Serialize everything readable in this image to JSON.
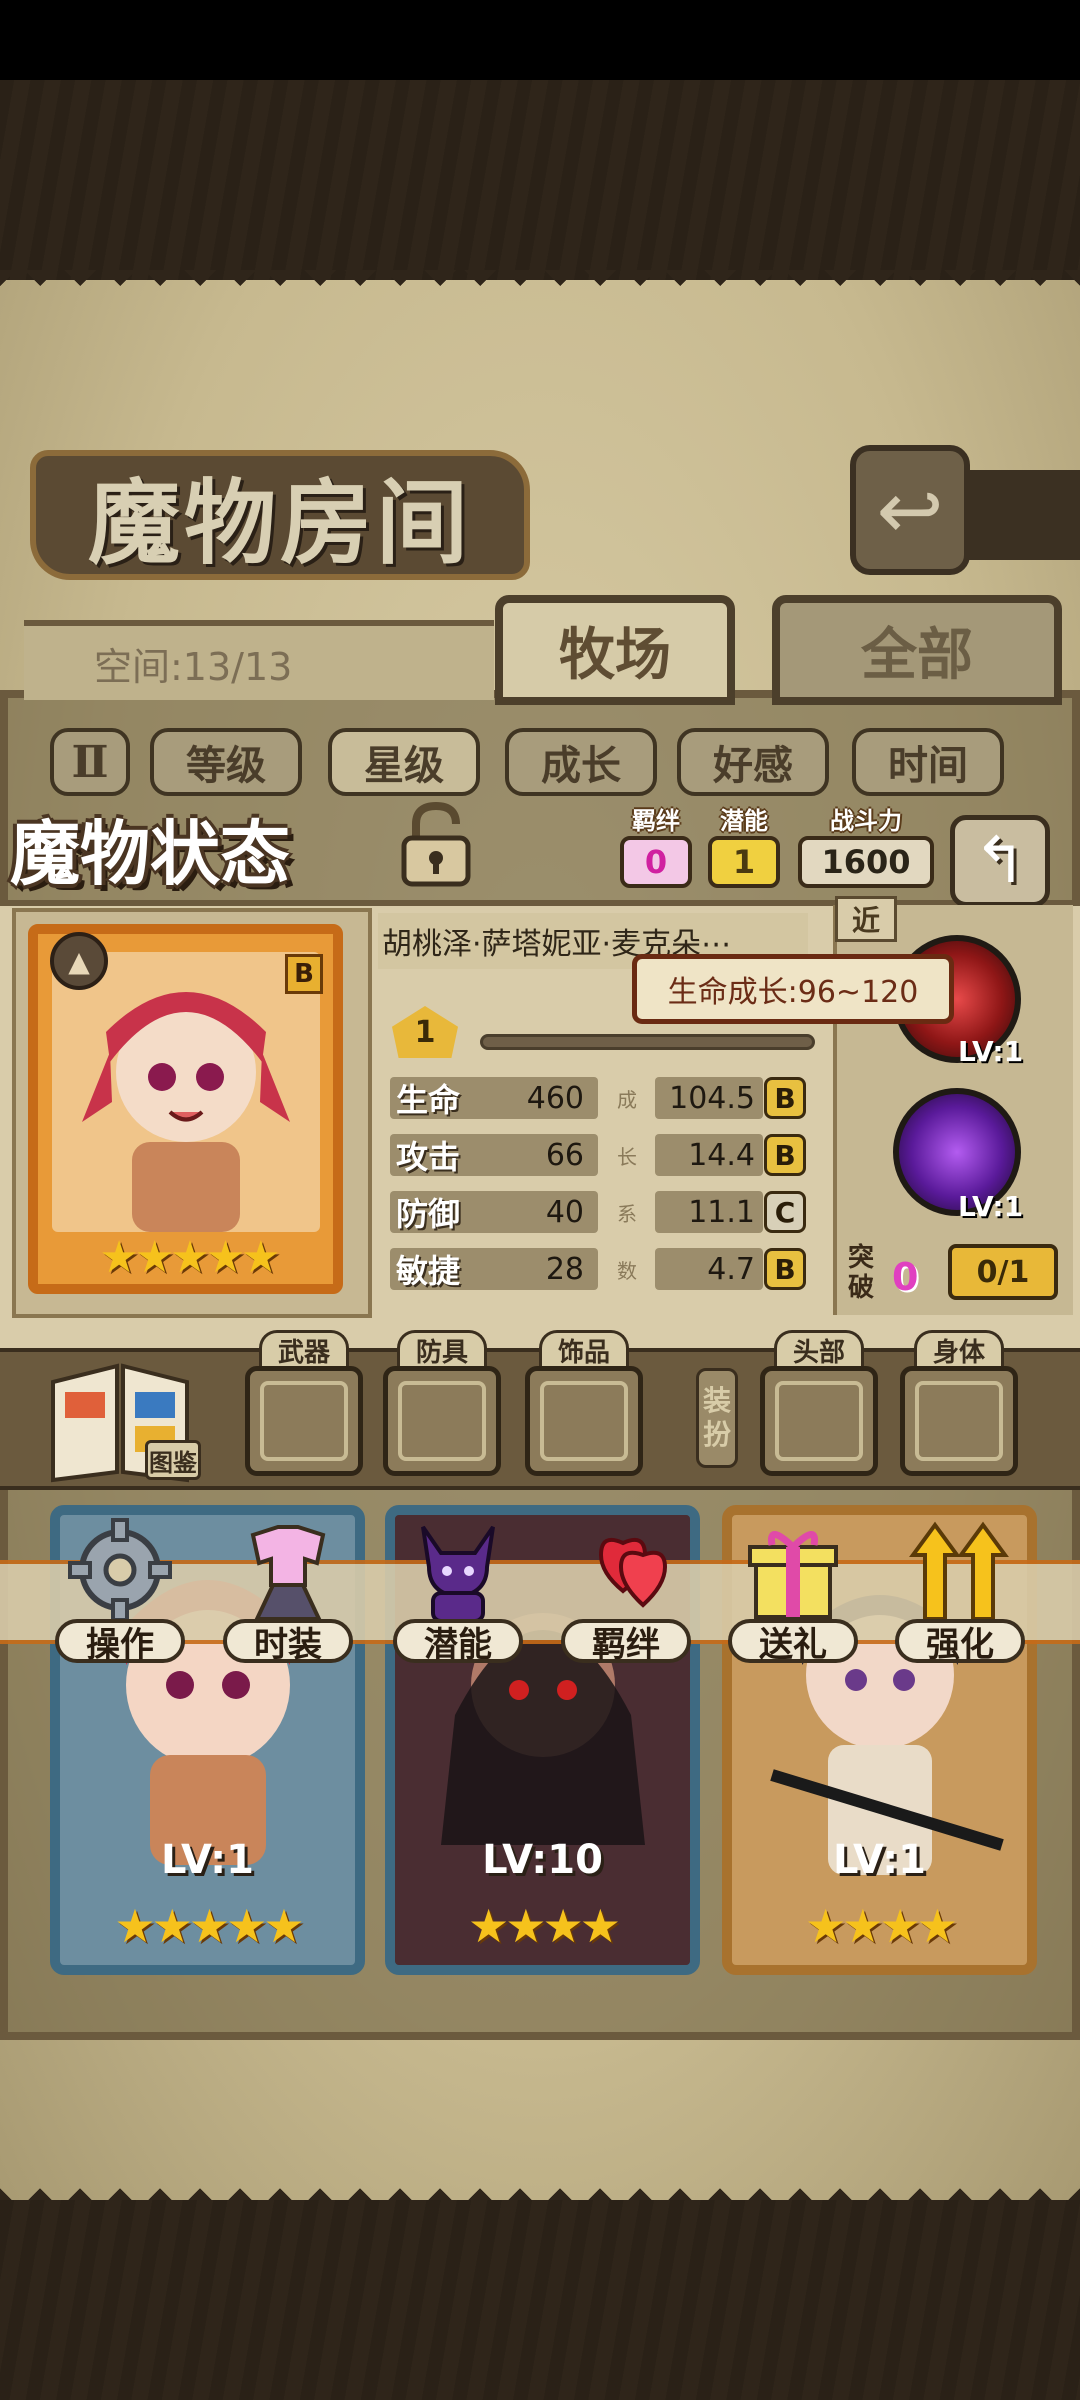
{
  "header": {
    "title": "魔物房间"
  },
  "storage": {
    "space_text": "空间:13/13"
  },
  "tabs": [
    {
      "label": "牧场"
    },
    {
      "label": "全部"
    }
  ],
  "sort": {
    "toggle_icon": "Ⅱ",
    "options": [
      "等级",
      "星级",
      "成长",
      "好感",
      "时间"
    ],
    "selected": "星级"
  },
  "status": {
    "title": "魔物状态",
    "bond": {
      "label": "羁绊",
      "value": "0"
    },
    "potential": {
      "label": "潜能",
      "value": "1"
    },
    "power": {
      "label": "战斗力",
      "value": "1600"
    },
    "monster_name": "胡桃泽·萨塔妮亚·麦克朵⋯",
    "rank": "B",
    "level_badge": "1",
    "tooltip": "生命成长:96~120",
    "stats": [
      {
        "name": "生命",
        "value": "460",
        "coef_char": "成",
        "coef": "104.5",
        "grade": "B"
      },
      {
        "name": "攻击",
        "value": "66",
        "coef_char": "长",
        "coef": "14.4",
        "grade": "B"
      },
      {
        "name": "防御",
        "value": "40",
        "coef_char": "系",
        "coef": "11.1",
        "grade": "C"
      },
      {
        "name": "敏捷",
        "value": "28",
        "coef_char": "数",
        "coef": "4.7",
        "grade": "B"
      }
    ],
    "stars": "★★★★★",
    "range": "近",
    "skills": [
      {
        "lv": "LV:1"
      },
      {
        "lv": "LV:1"
      }
    ],
    "breakthrough": {
      "label": "突破",
      "count": "0",
      "progress": "0/1"
    }
  },
  "equipment": {
    "codex_label": "图鉴",
    "slots": [
      "武器",
      "防具",
      "饰品",
      "头部",
      "身体"
    ],
    "dress_up_label": "装扮"
  },
  "actions": [
    {
      "label": "操作",
      "icon": "gear-icon"
    },
    {
      "label": "时装",
      "icon": "outfit-icon"
    },
    {
      "label": "潜能",
      "icon": "devil-silhouette-icon"
    },
    {
      "label": "羁绊",
      "icon": "hearts-icon"
    },
    {
      "label": "送礼",
      "icon": "gift-icon"
    },
    {
      "label": "强化",
      "icon": "upgrade-arrows-icon"
    }
  ],
  "roster": [
    {
      "lv": "LV:1",
      "stars": "★★★★★"
    },
    {
      "lv": "LV:10",
      "stars": "★★★★"
    },
    {
      "lv": "LV:1",
      "stars": "★★★★"
    }
  ],
  "colors": {
    "accent": "#c66b18",
    "parchment": "#d9ccaa",
    "frame": "#6b5a3e"
  }
}
